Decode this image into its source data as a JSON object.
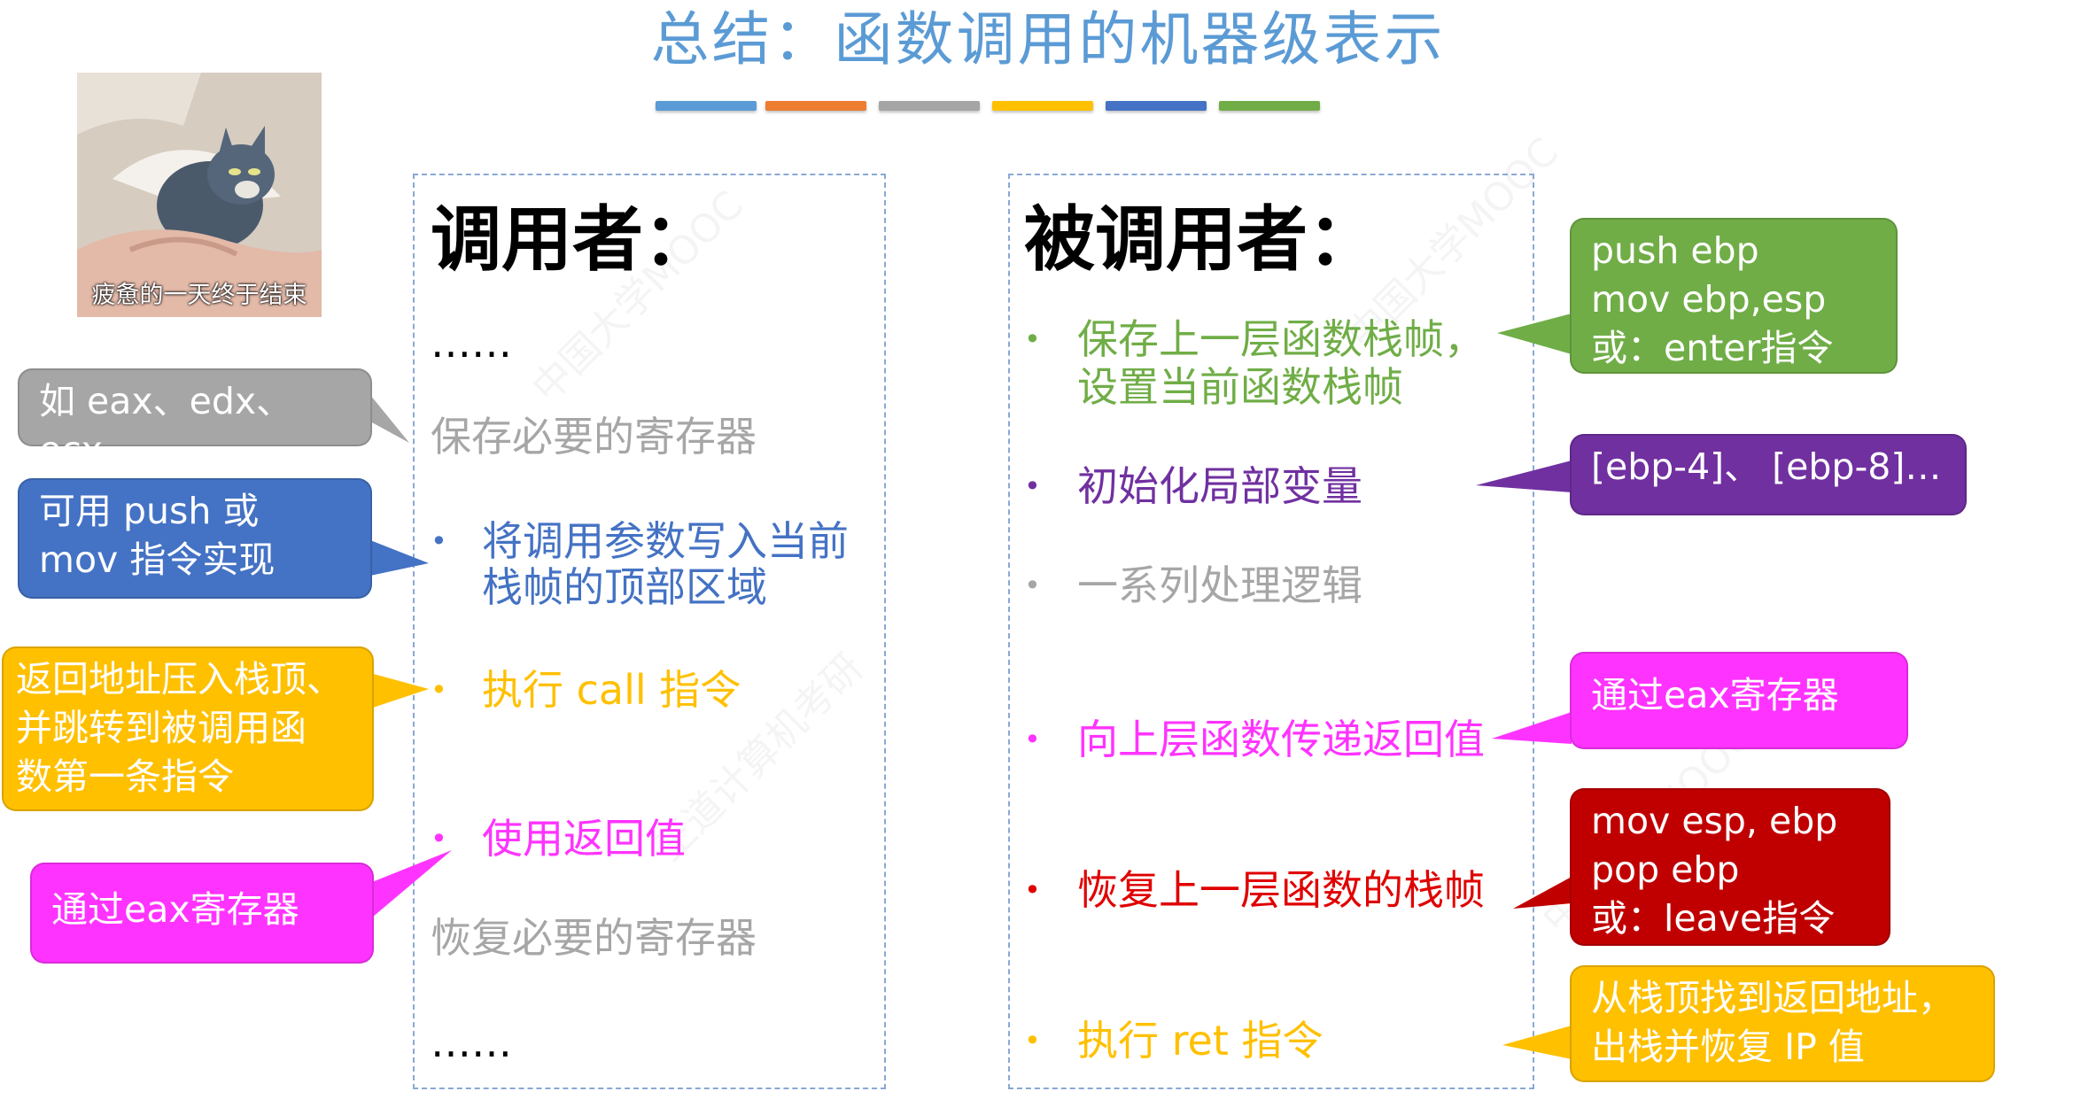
{
  "title": "总结：函数调用的机器级表示",
  "colors": {
    "title": "#5b9bd5",
    "stripes": [
      "#5b9bd5",
      "#ed7d31",
      "#a5a5a5",
      "#ffc000",
      "#4472c4",
      "#70ad47"
    ],
    "gray": "#a6a6a6",
    "blue": "#4472c4",
    "yellow": "#ffc000",
    "magenta": "#ff33ff",
    "green": "#70ad47",
    "purple": "#7030a0",
    "red": "#e00000",
    "callout_red": "#c00000"
  },
  "photo": {
    "caption": "疲惫的一天终于结束"
  },
  "caller": {
    "heading": "调用者：",
    "dots_top": "……",
    "save_regs": "保存必要的寄存器",
    "write_args_1": "将调用参数写入当前",
    "write_args_2": "栈帧的顶部区域",
    "exec_call": "执行 call 指令",
    "use_ret": "使用返回值",
    "restore_regs": "恢复必要的寄存器",
    "dots_bottom": "……"
  },
  "callee": {
    "heading": "被调用者：",
    "save_frame_1": "保存上一层函数栈帧，",
    "save_frame_2": "设置当前函数栈帧",
    "init_locals": "初始化局部变量",
    "logic": "一系列处理逻辑",
    "pass_ret": "向上层函数传递返回值",
    "restore_frame": "恢复上一层函数的栈帧",
    "exec_ret": "执行 ret 指令"
  },
  "callouts": {
    "regs_example": "如 eax、edx、ecx",
    "push_mov_1": "可用 push 或",
    "push_mov_2": "mov 指令实现",
    "call_desc_1": "返回地址压入栈顶、",
    "call_desc_2": "并跳转到被调用函",
    "call_desc_3": "数第一条指令",
    "use_eax": "通过eax寄存器",
    "enter_1": "push ebp",
    "enter_2": "mov ebp,esp",
    "enter_3": "或：enter指令",
    "locals_example": "[ebp-4]、 [ebp-8]…",
    "pass_eax": "通过eax寄存器",
    "leave_1": "mov esp, ebp",
    "leave_2": "pop ebp",
    "leave_3": "或：leave指令",
    "ret_1": "从栈顶找到返回地址，",
    "ret_2": "出栈并恢复 IP 值"
  },
  "watermarks": [
    "中国大学MOOC",
    "王道计算机考研"
  ]
}
